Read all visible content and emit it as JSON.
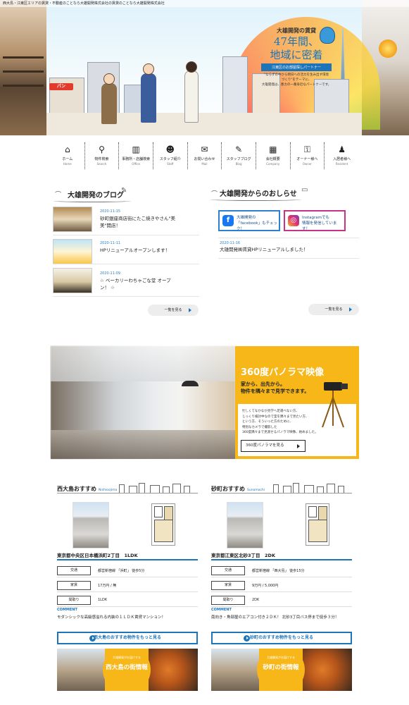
{
  "header": {
    "topbar": "西大島・江東区エリアの賃貸・不動産のことなら大雄開発株式会社の賃貸のことなら大雄開発株式会社",
    "tagline_small": "大雄開発の賃貸",
    "tagline_line1": "47年間、",
    "tagline_line2": "地域に密着",
    "band": "江東区のお部屋探しパートナー",
    "desc1": "\"ならずの中から明日への活力を生み出す環境",
    "desc2": "づくり\"をテーマに、",
    "desc3": "大雄開発は、墨カの一番身近なパートナーです。",
    "pan_sign": "パン"
  },
  "nav": [
    {
      "label": "ホーム",
      "sub": "Home",
      "icon": "home-icon",
      "glyph": "⌂"
    },
    {
      "label": "物件検索",
      "sub": "Search",
      "icon": "search-icon",
      "glyph": "⚲"
    },
    {
      "label": "事務所・店舗検索",
      "sub": "Office",
      "icon": "office-icon",
      "glyph": "▥"
    },
    {
      "label": "スタッフ紹介",
      "sub": "Staff",
      "icon": "staff-icon",
      "glyph": "☻"
    },
    {
      "label": "お問い合わせ",
      "sub": "Mail",
      "icon": "mail-icon",
      "glyph": "✉"
    },
    {
      "label": "スタッフブログ",
      "sub": "Blog",
      "icon": "blog-icon",
      "glyph": "✎"
    },
    {
      "label": "会社概要",
      "sub": "Company",
      "icon": "company-icon",
      "glyph": "▦"
    },
    {
      "label": "オーナー様へ",
      "sub": "Owner",
      "icon": "key-icon",
      "glyph": "⚿"
    },
    {
      "label": "入居者様へ",
      "sub": "Resident",
      "icon": "resident-icon",
      "glyph": "♟"
    }
  ],
  "blog": {
    "title": "大雄開発のブログ",
    "items": [
      {
        "date": "2020-11-15",
        "text1": "砂町銀座商店街にたこ焼きやさん\"美",
        "text2": "美\"開店！"
      },
      {
        "date": "2020-11-11",
        "text1": "HPリニューアルオープンします！",
        "text2": ""
      },
      {
        "date": "2020-11-09",
        "text1": "☆ ベーカリーわちゃごな堂 オープ",
        "text2": "ン！ ☆"
      }
    ],
    "more": "一覧を見る"
  },
  "news": {
    "title": "大雄開発からのおしらせ",
    "facebook1": "大雄開発の",
    "facebook2": "「facebook」もチェック！",
    "instagram1": "Instagramでも",
    "instagram2": "情報を発信しています！",
    "items": [
      {
        "date": "2020-11-16",
        "text": "大雄開発㈱賃貸HPリニューアルしました！"
      }
    ],
    "more": "一覧を見る"
  },
  "panorama": {
    "title": "360度パノラマ映像",
    "sub1": "家から、出先から。",
    "sub2": "物件を隅々まで見学できます。",
    "desc": [
      "忙しくてなかなか見学へ足運べない方、",
      "じっくり検討中なので室を隅々まで見たい方、",
      "という方、そういった方のために、",
      "特別なカメラで撮影した",
      "360度隅々まで見渡せるパノラマ映像、始めました。"
    ],
    "button": "360度パノラマを見る"
  },
  "recommend": [
    {
      "title": "西大島おすすめ",
      "sub": "Nishioojima",
      "address": "東京都中央区日本橋浜町2丁目　1LDK",
      "rows": [
        {
          "k": "交通",
          "v": "都営新宿線 「浜町」 徒歩5分"
        },
        {
          "k": "家賃",
          "v": "17万円 / 無"
        },
        {
          "k": "間取り",
          "v": "1LDK"
        }
      ],
      "comment_h": "COMMENT",
      "comment": "モダンシックな高級感溢れる内装の１ＬＤＫ賃貸マンション！",
      "button": "西大島のおすすめ物件をもっと見る",
      "town_small": "大雄開発がお届けする",
      "town_big": "西大島の街情報"
    },
    {
      "title": "砂町おすすめ",
      "sub": "Sunamachi",
      "address": "東京都江東区北砂3丁目　2DK",
      "rows": [
        {
          "k": "交通",
          "v": "都営新宿線 「西大島」 徒歩15分"
        },
        {
          "k": "家賃",
          "v": "9万円 / 5,000円"
        },
        {
          "k": "間取り",
          "v": "2DK"
        }
      ],
      "comment_h": "COMMENT",
      "comment": "南向き・角部屋のエアコン付き２ＤＫ！ 北砂3丁目バス停まで徒歩３分！",
      "button": "砂町のおすすめ物件をもっと見る",
      "town_small": "大雄開発がお届けする",
      "town_big": "砂町の街情報"
    }
  ]
}
